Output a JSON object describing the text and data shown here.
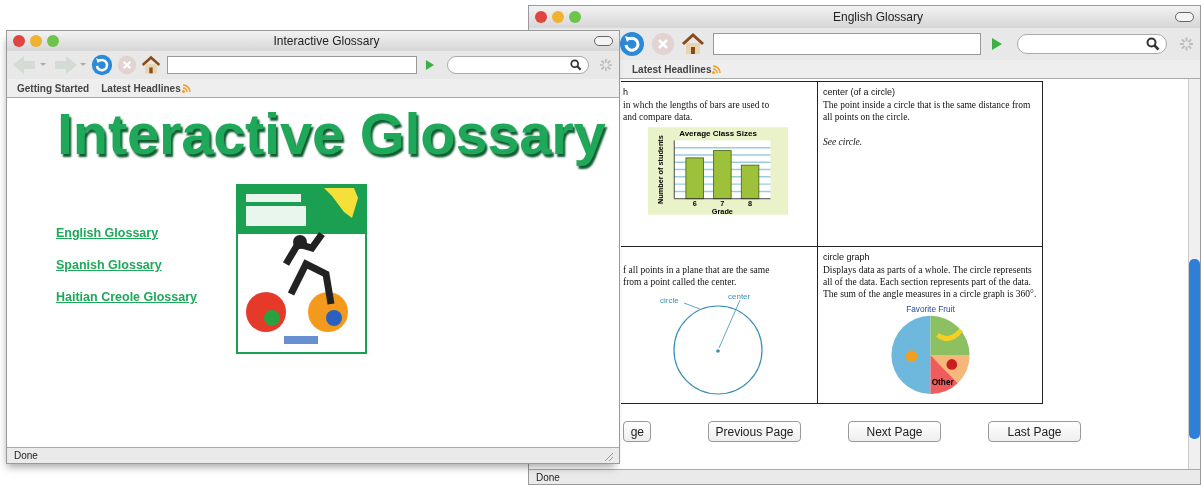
{
  "back_window": {
    "title": "English Glossary",
    "bookmarks": [
      "Latest Headlines"
    ],
    "entries": [
      {
        "term": "h",
        "lines": [
          "in whch the lengths of bars are used to",
          "and compare data."
        ],
        "figure": {
          "kind": "bar",
          "title": "Average Class Sizes",
          "ylabel": "Number of students",
          "xlabel": "Grade",
          "categories": [
            "6",
            "7",
            "8"
          ]
        }
      },
      {
        "term": "center (of a circle)",
        "definition": "The point inside a circle that is the same distance from all points on the circle.",
        "note": "See circle."
      },
      {
        "lines": [
          "f all points in a plane that are the same",
          "from a point called the center."
        ],
        "figure": {
          "kind": "circle",
          "labels": [
            "circle",
            "center"
          ]
        }
      },
      {
        "term": "circle graph",
        "definition": "Displays data as parts of a whole. The circle represents all of the data. Each section represents part of the data. The sum of the angle measures in a circle graph is 360°.",
        "figure": {
          "kind": "pie",
          "title": "Favorite Fruit",
          "labels": [
            "Other"
          ]
        }
      }
    ],
    "pager": [
      "ge",
      "Previous Page",
      "Next Page",
      "Last Page"
    ],
    "status": "Done"
  },
  "front_window": {
    "title": "Interactive Glossary",
    "bookmarks": [
      "Getting Started",
      "Latest Headlines"
    ],
    "heading": "Interactive Glossary",
    "links": [
      "English Glossary",
      "Spanish Glossary",
      "Haitian Creole Glossary"
    ],
    "status": "Done"
  }
}
